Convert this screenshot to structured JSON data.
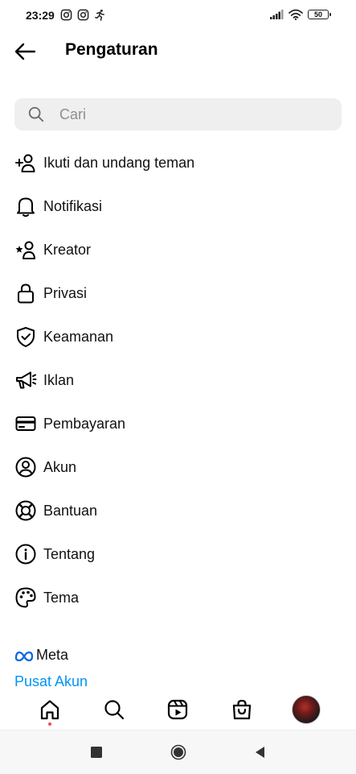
{
  "status_bar": {
    "time": "23:29",
    "left_icons": [
      "instagram-icon",
      "instagram-icon",
      "running-person-icon"
    ],
    "right_icons": [
      "signal-icon",
      "wifi-icon",
      "battery-icon"
    ],
    "battery_level": "50"
  },
  "header": {
    "back_icon": "arrow-left-icon",
    "title": "Pengaturan"
  },
  "search": {
    "placeholder": "Cari",
    "icon": "search-icon"
  },
  "menu": {
    "items": [
      {
        "label": "Ikuti dan undang teman",
        "icon": "add-person-icon"
      },
      {
        "label": "Notifikasi",
        "icon": "bell-icon"
      },
      {
        "label": "Kreator",
        "icon": "star-person-icon"
      },
      {
        "label": "Privasi",
        "icon": "lock-icon"
      },
      {
        "label": "Keamanan",
        "icon": "shield-check-icon"
      },
      {
        "label": "Iklan",
        "icon": "megaphone-icon"
      },
      {
        "label": "Pembayaran",
        "icon": "card-icon"
      },
      {
        "label": "Akun",
        "icon": "account-circle-icon"
      },
      {
        "label": "Bantuan",
        "icon": "lifebuoy-icon"
      },
      {
        "label": "Tentang",
        "icon": "info-icon"
      },
      {
        "label": "Tema",
        "icon": "palette-icon"
      }
    ]
  },
  "footer": {
    "brand": "Meta",
    "accounts_link": "Pusat Akun"
  },
  "bottom_nav": {
    "items": [
      "home-icon",
      "search-icon",
      "reels-icon",
      "shop-icon",
      "profile-avatar"
    ]
  },
  "colors": {
    "link": "#0095f6",
    "search_bg": "#efefef",
    "notification_dot": "#ed4956"
  }
}
